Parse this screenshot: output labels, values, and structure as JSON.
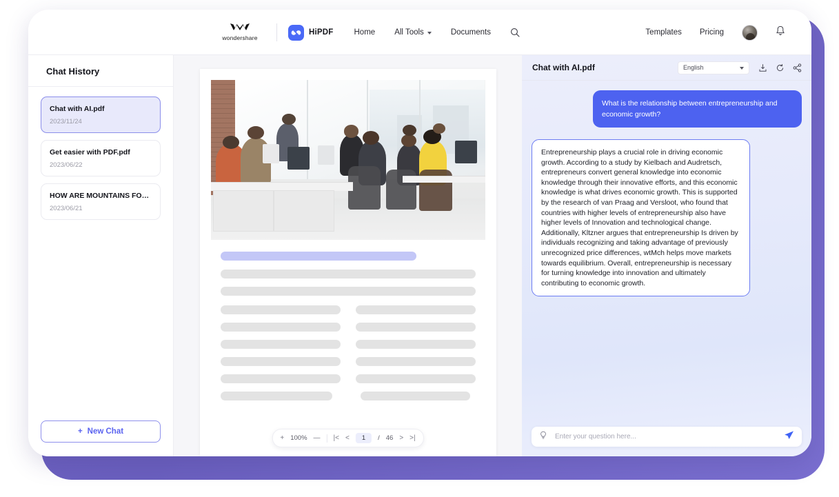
{
  "nav": {
    "brand_name": "wondershare",
    "product": "HiPDF",
    "links": [
      "Home",
      "All Tools",
      "Documents"
    ],
    "search_icon": "search-icon",
    "right_links": [
      "Templates",
      "Pricing"
    ],
    "bell_icon": "bell-icon",
    "avatar": "user-avatar"
  },
  "sidebar": {
    "title": "Chat History",
    "items": [
      {
        "name": "Chat with AI.pdf",
        "date": "2023/11/24",
        "active": true
      },
      {
        "name": "Get easier with PDF.pdf",
        "date": "2023/06/22",
        "active": false
      },
      {
        "name": "HOW ARE MOUNTAINS FORME...",
        "date": "2023/06/21",
        "active": false
      }
    ],
    "new_chat_label": "New Chat",
    "new_chat_plus": "+"
  },
  "viewer": {
    "zoom_in": "+",
    "zoom_level": "100%",
    "zoom_out": "—",
    "first_page": "|<",
    "prev_page": "<",
    "current_page": "1",
    "page_separator": "/",
    "total_pages": "46",
    "next_page": ">",
    "last_page": ">|"
  },
  "chat": {
    "title": "Chat with AI.pdf",
    "language": "English",
    "icons": [
      "download-icon",
      "refresh-icon",
      "share-icon"
    ],
    "question": "What is the relationship between entrepreneurship and economic growth?",
    "answer": "Entrepreneurship plays a crucial role in driving economic growth. According to a study by Kielbach and Audretsch, entrepreneurs convert general knowledge into economic knowledge through their innovative efforts, and this economic knowledge is what drives economic growth. This is supported by the research of van Praag and Versloot, who found that countries with higher levels of entrepreneurship also have higher levels of Innovation and technological change. Additionally, Kltzner argues that entrepreneurship Is driven by individuals recognizing and taking advantage of previously unrecognized price differences, wtMch helps move markets towards equilibrium. Overall, entrepreneurship is necessary for turning knowledge into innovation and ultimately contributing to economic growth.",
    "input_placeholder": "Enter your question here...",
    "input_value": "",
    "hint_icon": "lightbulb-icon",
    "send_icon": "send-icon"
  },
  "colors": {
    "accent_blue": "#4d62f0",
    "brand_purple": "#6f63c4",
    "highlight_bar": "#c3c7f7"
  }
}
